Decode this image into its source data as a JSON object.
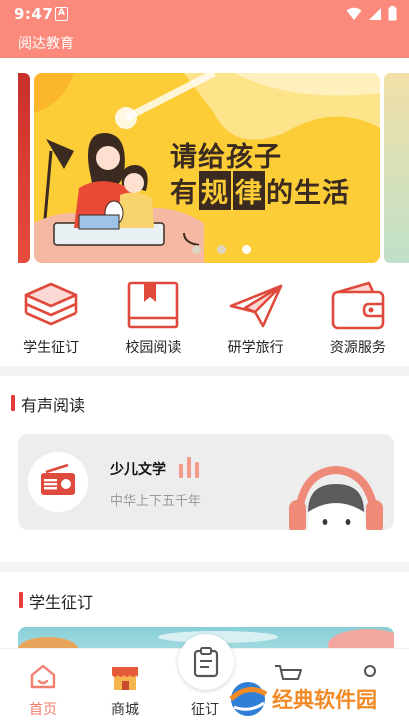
{
  "status_bar": {
    "time": "9:47",
    "notification_glyph": "A"
  },
  "app": {
    "title": "阅达教育"
  },
  "banner": {
    "line1": "请给孩子",
    "line2_pre": "有",
    "line2_box1": "规",
    "line2_box2": "律",
    "line2_post": "的生活",
    "dot_count": 3,
    "active_dot": 3,
    "colors": {
      "background": "#fccd37",
      "text": "#3a2a1f"
    }
  },
  "quick_nav": [
    {
      "label": "学生征订",
      "icon": "stacked-books-icon"
    },
    {
      "label": "校园阅读",
      "icon": "open-book-icon"
    },
    {
      "label": "研学旅行",
      "icon": "paper-plane-icon"
    },
    {
      "label": "资源服务",
      "icon": "wallet-icon"
    }
  ],
  "audio_section": {
    "title": "有声阅读",
    "card": {
      "title": "少儿文学",
      "subtitle": "中华上下五千年",
      "icon": "radio-icon"
    }
  },
  "order_section": {
    "title": "学生征订"
  },
  "bottom_nav": [
    {
      "label": "首页",
      "icon": "home-icon",
      "active": true
    },
    {
      "label": "商城",
      "icon": "shop-icon",
      "active": false
    },
    {
      "label": "征订",
      "icon": "clipboard-icon",
      "active": false
    },
    {
      "label": "",
      "icon": "cart-icon",
      "active": false
    },
    {
      "label": "",
      "icon": "profile-icon",
      "active": false
    }
  ],
  "watermark": {
    "text": "经典软件园"
  },
  "colors": {
    "accent": "#fb8a7d",
    "section_marker": "#e83c3c",
    "icon_red": "#e04a3c",
    "active_tab": "#f2806f"
  }
}
